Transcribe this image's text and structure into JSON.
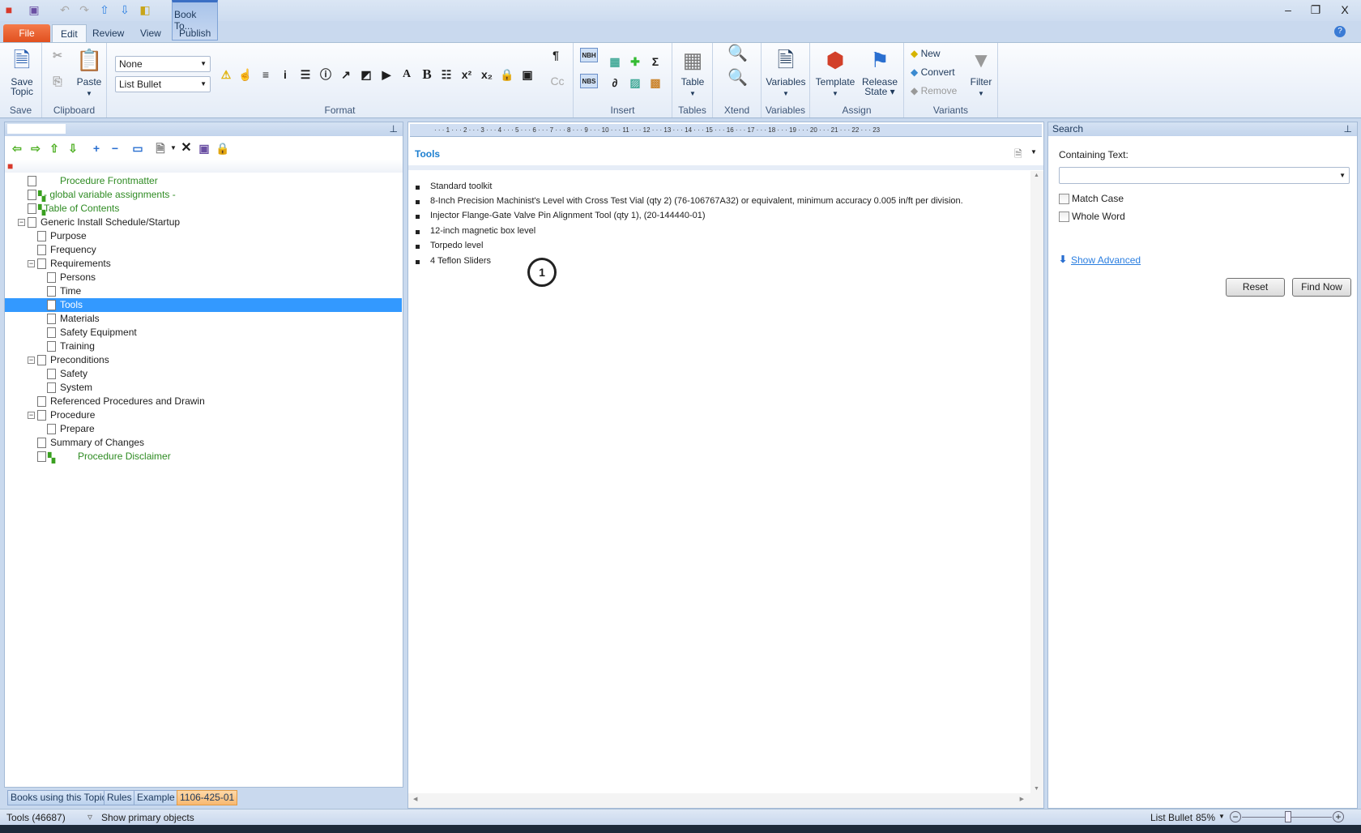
{
  "qat": {
    "icons": [
      "app-book-icon",
      "save-icon",
      "undo-icon",
      "redo-icon",
      "move-up-icon",
      "move-down-icon",
      "preview-icon"
    ]
  },
  "context_tab": {
    "title": "Book To...",
    "tab": "Publish"
  },
  "window": {
    "minimize": "–",
    "restore": "❐",
    "close": "X"
  },
  "tabs": [
    "File",
    "Edit",
    "Review",
    "View"
  ],
  "ribbon": {
    "save": {
      "button": "Save",
      "button2": "Topic",
      "label": "Save"
    },
    "clipboard": {
      "paste": "Paste",
      "label": "Clipboard"
    },
    "format": {
      "style_combo": "None",
      "para_combo": "List Bullet",
      "label": "Format"
    },
    "insert": {
      "label": "Insert",
      "nbh": "NBH",
      "nbs": "NBS"
    },
    "tables": {
      "table": "Table",
      "label": "Tables"
    },
    "xtend": {
      "label": "Xtend"
    },
    "variables": {
      "button": "Variables",
      "label": "Variables"
    },
    "assign": {
      "template": "Template",
      "release": "Release",
      "state": "State",
      "label": "Assign"
    },
    "variants": {
      "new": "New",
      "convert": "Convert",
      "remove": "Remove",
      "filter": "Filter",
      "label": "Variants"
    }
  },
  "tree": {
    "items": [
      {
        "label": "Procedure Frontmatter",
        "level": 0,
        "green": true
      },
      {
        "label": "- global variable assignments -",
        "level": 0,
        "green": true
      },
      {
        "label": "Table of Contents",
        "level": 0,
        "green": true
      },
      {
        "label": "Generic Install Schedule/Startup",
        "level": 0,
        "expand": true
      },
      {
        "label": "Purpose",
        "level": 1
      },
      {
        "label": "Frequency",
        "level": 1
      },
      {
        "label": "Requirements",
        "level": 1,
        "expand": true
      },
      {
        "label": "Persons",
        "level": 2
      },
      {
        "label": "Time",
        "level": 2
      },
      {
        "label": "Tools",
        "level": 2,
        "selected": true
      },
      {
        "label": "Materials",
        "level": 2
      },
      {
        "label": "Safety Equipment",
        "level": 2
      },
      {
        "label": "Training",
        "level": 2
      },
      {
        "label": "Preconditions",
        "level": 1,
        "expand": true
      },
      {
        "label": "Safety",
        "level": 2
      },
      {
        "label": "System",
        "level": 2
      },
      {
        "label": "Referenced Procedures and Drawin",
        "level": 1
      },
      {
        "label": "Procedure",
        "level": 1,
        "expand": true
      },
      {
        "label": "Prepare",
        "level": 2
      },
      {
        "label": "Summary of Changes",
        "level": 1
      },
      {
        "label": "Procedure Disclaimer",
        "level": 1,
        "green": true
      }
    ]
  },
  "bottom_tabs": [
    "Books using this Topic",
    "Rules",
    "Example",
    "1106-425-01"
  ],
  "editor": {
    "title": "Tools",
    "items": [
      "Standard toolkit",
      "8-Inch Precision Machinist's Level with Cross Test Vial (qty 2) (76-106767A32) or equivalent, minimum accuracy 0.005 in/ft per division.",
      "Injector Flange-Gate Valve Pin Alignment Tool (qty 1), (20-144440-01)",
      "12-inch magnetic box level",
      "Torpedo level",
      "4 Teflon Sliders"
    ],
    "callout": "1"
  },
  "search": {
    "title": "Search",
    "containing_label": "Containing Text:",
    "containing_value": "",
    "match_case": "Match Case",
    "whole_word": "Whole Word",
    "show_advanced": "Show Advanced",
    "reset": "Reset",
    "find_now": "Find Now"
  },
  "status": {
    "left": "Tools (46687)",
    "filter": "Show primary objects",
    "style": "List Bullet",
    "zoom": "85%",
    "zoom_level_percent": 85
  }
}
